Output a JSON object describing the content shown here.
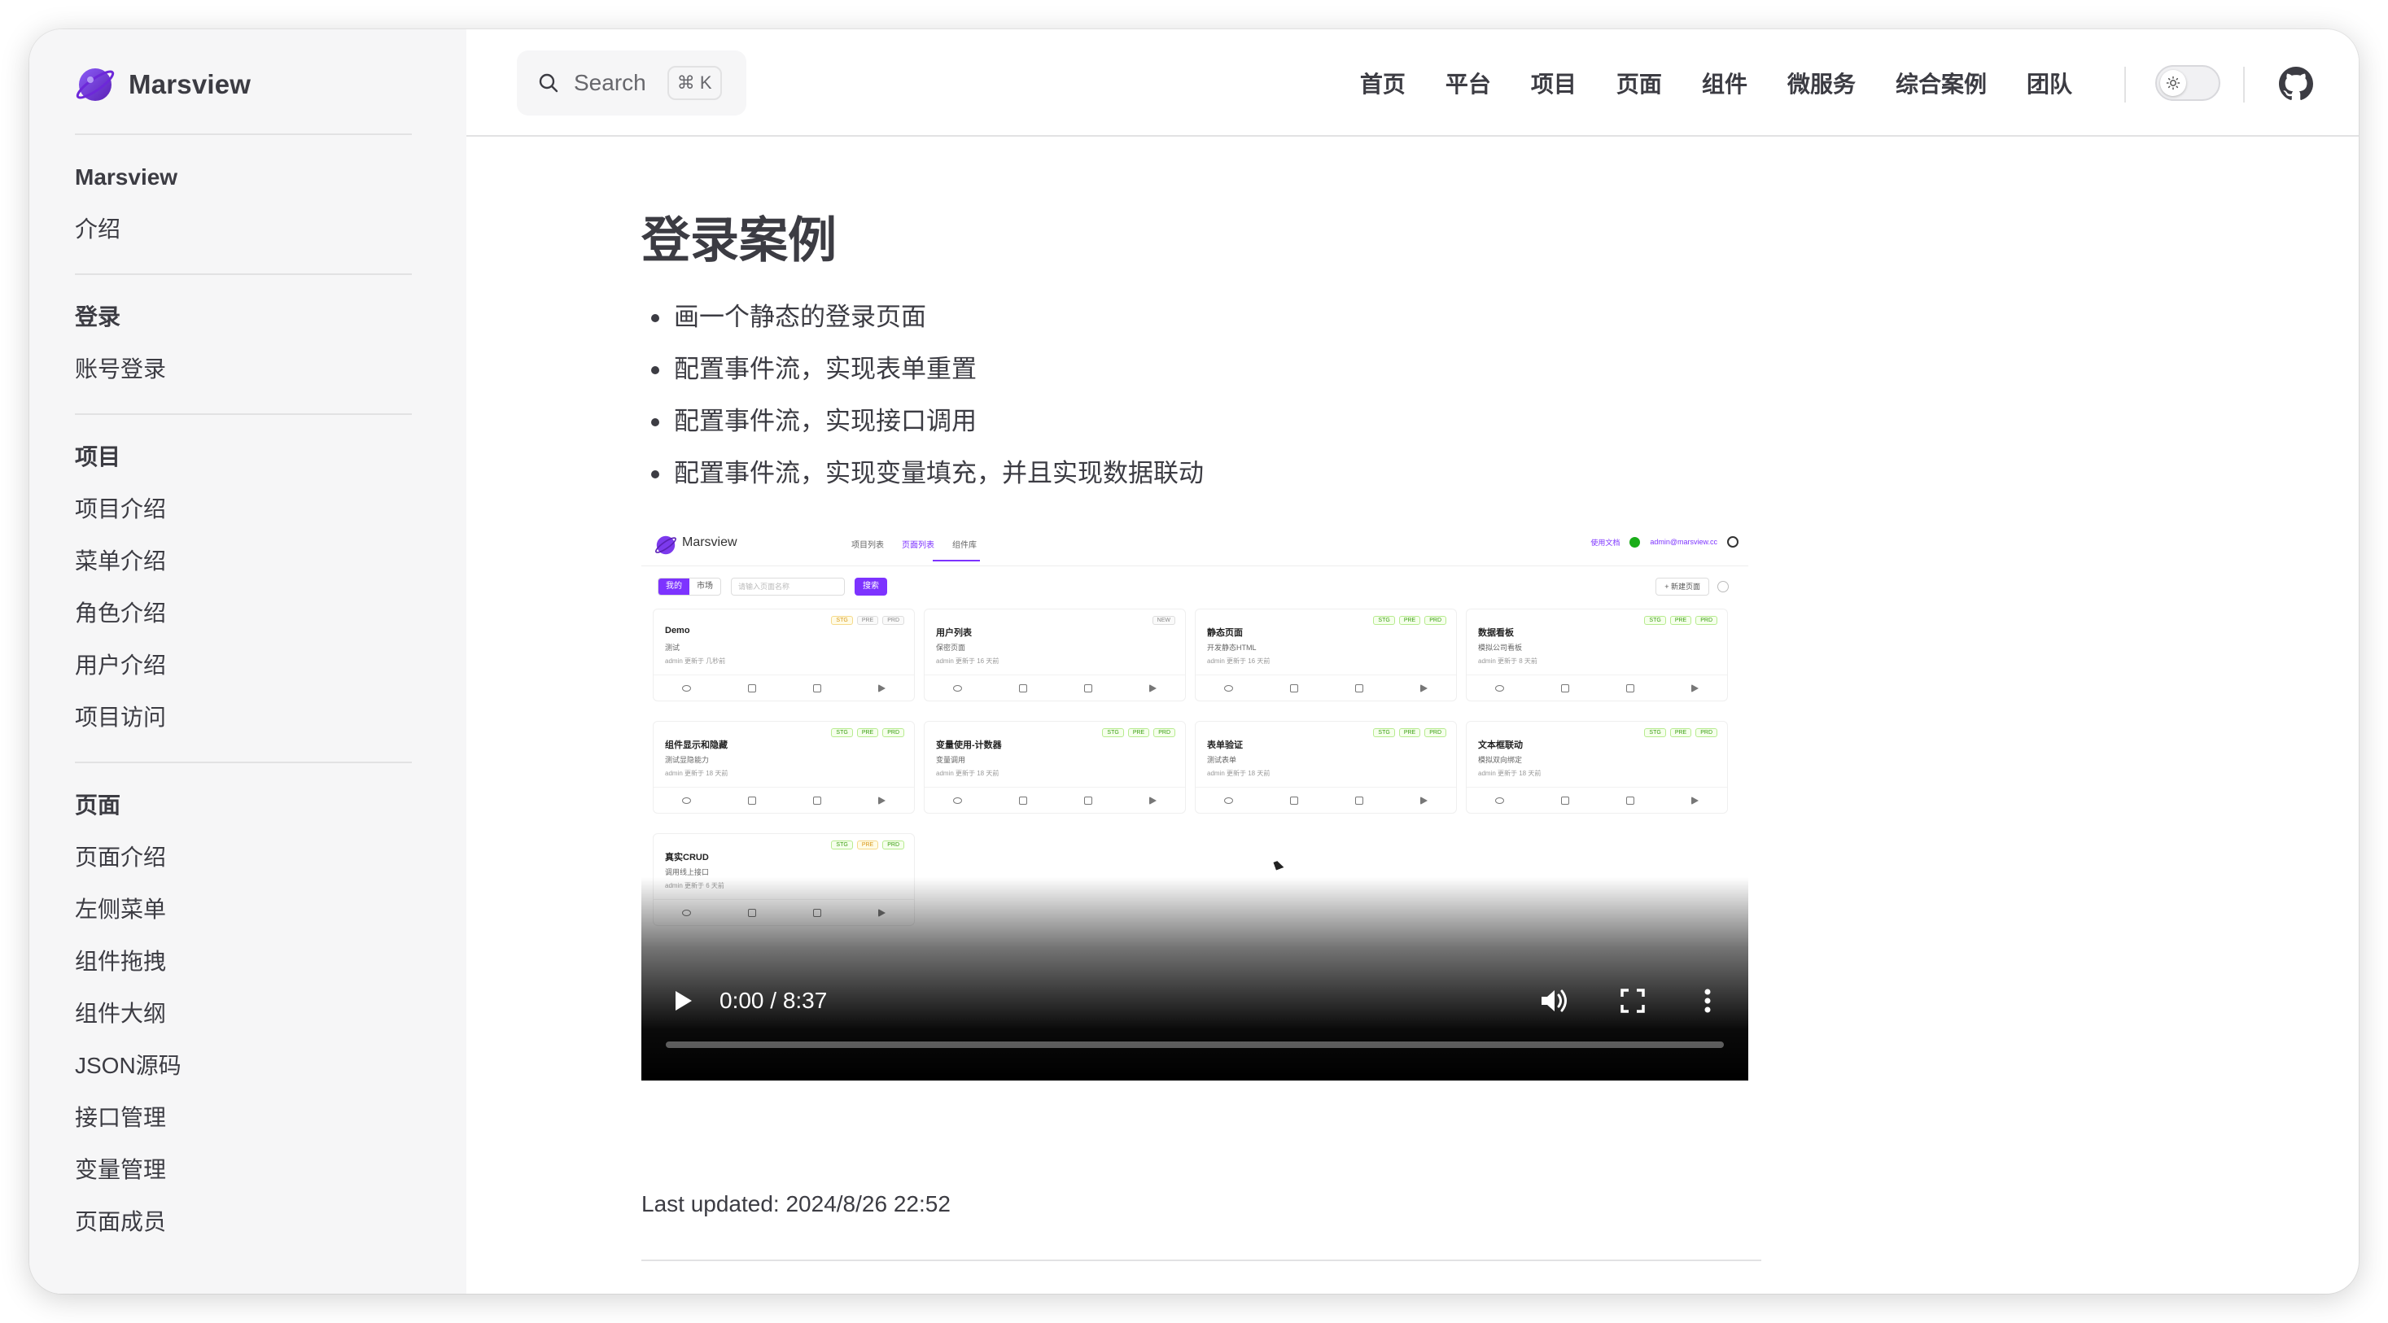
{
  "brand": {
    "name": "Marsview",
    "logo_icon": "planet-logo-icon",
    "accent": "#7d33ff"
  },
  "sidebar": {
    "groups": [
      {
        "title": "Marsview",
        "items": [
          "介绍"
        ]
      },
      {
        "title": "登录",
        "items": [
          "账号登录"
        ]
      },
      {
        "title": "项目",
        "items": [
          "项目介绍",
          "菜单介绍",
          "角色介绍",
          "用户介绍",
          "项目访问"
        ]
      },
      {
        "title": "页面",
        "items": [
          "页面介绍",
          "左侧菜单",
          "组件拖拽",
          "组件大纲",
          "JSON源码",
          "接口管理",
          "变量管理",
          "页面成员"
        ]
      }
    ]
  },
  "topbar": {
    "search": {
      "label": "Search",
      "shortcut": "⌘ K",
      "icon": "search-icon"
    },
    "links": [
      "首页",
      "平台",
      "项目",
      "页面",
      "组件",
      "微服务",
      "综合案例",
      "团队"
    ],
    "theme_toggle_icon": "sun-icon",
    "github_icon": "github-icon"
  },
  "content": {
    "title": "登录案例",
    "bullets": [
      "画一个静态的登录页面",
      "配置事件流，实现表单重置",
      "配置事件流，实现接口调用",
      "配置事件流，实现变量填充，并且实现数据联动"
    ]
  },
  "video": {
    "time": "0:00 / 8:37",
    "progress": 0,
    "screen": {
      "brand": "Marsview",
      "tabs": [
        "项目列表",
        "页面列表",
        "组件库"
      ],
      "active_tab": 1,
      "header_right": [
        "使用文档",
        "admin@marsview.cc"
      ],
      "segments": [
        "我的",
        "市场"
      ],
      "search_placeholder": "请输入页面名称",
      "search_button": "搜索",
      "new_button": "+ 新建页面",
      "cards": [
        {
          "name": "Demo",
          "desc": "测试",
          "meta": "admin 更新于 几秒前",
          "tags": [
            [
              "STG",
              "stg-y"
            ],
            [
              "PRE",
              "gray"
            ],
            [
              "PRD",
              "gray"
            ]
          ]
        },
        {
          "name": "用户列表",
          "desc": "保密页面",
          "meta": "admin 更新于 16 天前",
          "tags": [
            [
              "NEW",
              "gray"
            ]
          ]
        },
        {
          "name": "静态页面",
          "desc": "开发静态HTML",
          "meta": "admin 更新于 16 天前",
          "tags": [
            [
              "STG",
              "stg-g"
            ],
            [
              "PRE",
              "pre-g"
            ],
            [
              "PRD",
              "prd-g"
            ]
          ]
        },
        {
          "name": "数据看板",
          "desc": "模拟公司看板",
          "meta": "admin 更新于 8 天前",
          "tags": [
            [
              "STG",
              "stg-g"
            ],
            [
              "PRE",
              "pre-g"
            ],
            [
              "PRD",
              "prd-g"
            ]
          ]
        },
        {
          "name": "组件显示和隐藏",
          "desc": "测试显隐能力",
          "meta": "admin 更新于 18 天前",
          "tags": [
            [
              "STG",
              "stg-g"
            ],
            [
              "PRE",
              "pre-g"
            ],
            [
              "PRD",
              "prd-g"
            ]
          ]
        },
        {
          "name": "变量使用-计数器",
          "desc": "变量调用",
          "meta": "admin 更新于 18 天前",
          "tags": [
            [
              "STG",
              "stg-g"
            ],
            [
              "PRE",
              "pre-g"
            ],
            [
              "PRD",
              "prd-g"
            ]
          ]
        },
        {
          "name": "表单验证",
          "desc": "测试表单",
          "meta": "admin 更新于 18 天前",
          "tags": [
            [
              "STG",
              "stg-g"
            ],
            [
              "PRE",
              "pre-g"
            ],
            [
              "PRD",
              "prd-g"
            ]
          ]
        },
        {
          "name": "文本框联动",
          "desc": "模拟双向绑定",
          "meta": "admin 更新于 18 天前",
          "tags": [
            [
              "STG",
              "stg-g"
            ],
            [
              "PRE",
              "pre-g"
            ],
            [
              "PRD",
              "prd-g"
            ]
          ]
        },
        {
          "name": "真实CRUD",
          "desc": "调用线上接口",
          "meta": "admin 更新于 6 天前",
          "tags": [
            [
              "STG",
              "stg-g"
            ],
            [
              "PRE",
              "pre-y"
            ],
            [
              "PRD",
              "prd-g"
            ]
          ]
        }
      ]
    }
  },
  "footer": {
    "last_updated": "Last updated: 2024/8/26 22:52"
  }
}
